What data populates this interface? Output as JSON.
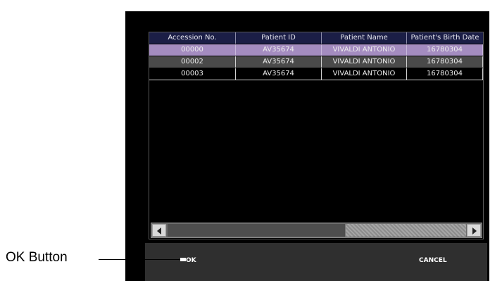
{
  "table": {
    "columns": [
      "Accession No.",
      "Patient ID",
      "Patient Name",
      "Patient's Birth Date"
    ],
    "rows": [
      [
        "00000",
        "AV35674",
        "VIVALDI ANTONIO",
        "16780304"
      ],
      [
        "00002",
        "AV35674",
        "VIVALDI ANTONIO",
        "16780304"
      ],
      [
        "00003",
        "AV35674",
        "VIVALDI ANTONIO",
        "16780304"
      ]
    ],
    "selected_row": 0
  },
  "buttons": {
    "ok_label": "OK",
    "cancel_label": "CANCEL"
  },
  "callout": {
    "label": "OK Button"
  },
  "colors": {
    "selected_row": "#a48cc0",
    "header": "#1b1e46",
    "alt_row": "#4a4a4a"
  }
}
